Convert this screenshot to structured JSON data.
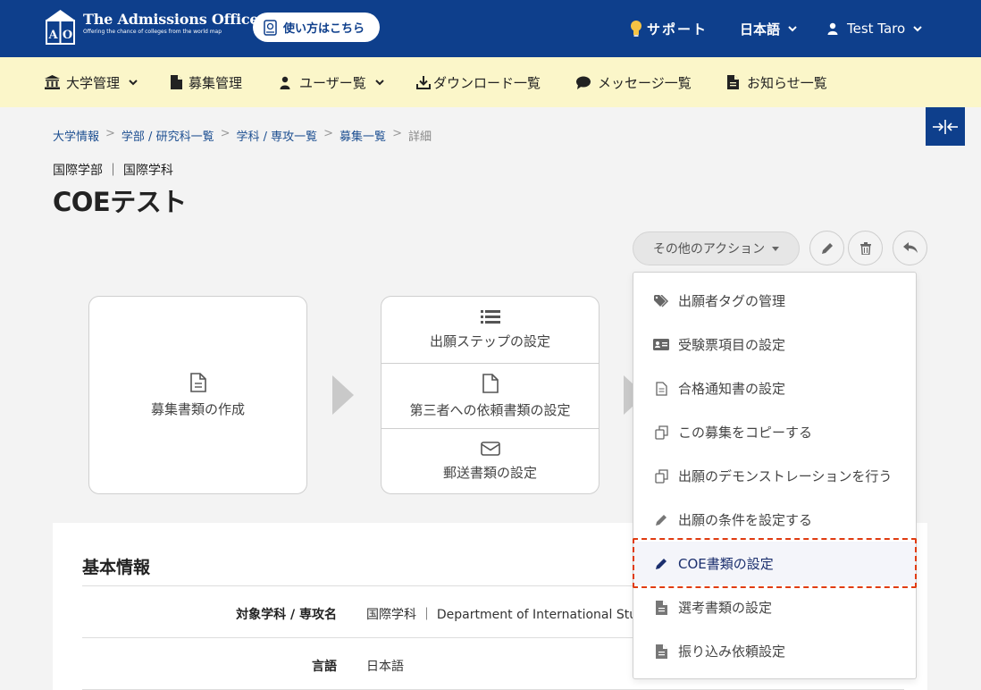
{
  "header": {
    "logo_title": "The Admissions Office",
    "logo_sub": "Offering the chance of colleges from the world map",
    "howto_label": "使い方はこちら",
    "support_label": "サポート",
    "language_label": "日本語",
    "user_label": "Test Taro"
  },
  "nav": {
    "items": [
      {
        "label": "大学管理"
      },
      {
        "label": "募集管理"
      },
      {
        "label": "ユーザー覧"
      },
      {
        "label": "ダウンロード一覧"
      },
      {
        "label": "メッセージ一覧"
      },
      {
        "label": "お知らせ一覧"
      }
    ]
  },
  "breadcrumb": [
    "大学情報",
    "学部 / 研究科一覧",
    "学科 / 専攻一覧",
    "募集一覧",
    "詳細"
  ],
  "page": {
    "subtitle": "国際学部 ｜ 国際学科",
    "title": "COEテスト",
    "actions_label": "その他のアクション"
  },
  "steps": {
    "card1": "募集書類の作成",
    "card2": [
      "出願ステップの設定",
      "第三者への依頼書類の設定",
      "郵送書類の設定"
    ]
  },
  "info": {
    "heading": "基本情報",
    "rows": [
      {
        "label": "対象学科 / 専攻名",
        "value": "国際学科 ｜ Department of International Stu"
      },
      {
        "label": "言語",
        "value": "日本語"
      }
    ]
  },
  "menu": {
    "items": [
      {
        "label": "出願者タグの管理",
        "icon": "tags-icon"
      },
      {
        "label": "受験票項目の設定",
        "icon": "id-card-icon"
      },
      {
        "label": "合格通知書の設定",
        "icon": "document-icon"
      },
      {
        "label": "この募集をコピーする",
        "icon": "copy-icon"
      },
      {
        "label": "出願のデモンストレーションを行う",
        "icon": "copy-icon"
      },
      {
        "label": "出願の条件を設定する",
        "icon": "pencil-icon"
      },
      {
        "label": "COE書類の設定",
        "icon": "pencil-icon",
        "active": true
      },
      {
        "label": "選考書類の設定",
        "icon": "file-icon"
      },
      {
        "label": "振り込み依頼設定",
        "icon": "file-icon"
      }
    ]
  },
  "colors": {
    "primary": "#0e3f8c",
    "nav_bg": "#fbf6c9",
    "highlight": "#e03b10"
  }
}
